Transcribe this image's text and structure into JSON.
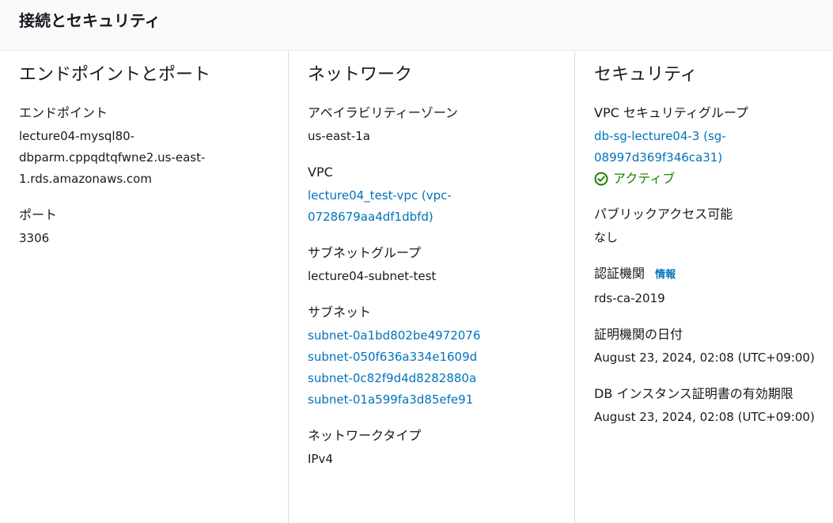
{
  "header": {
    "title": "接続とセキュリティ"
  },
  "endpoint_section": {
    "title": "エンドポイントとポート",
    "endpoint_label": "エンドポイント",
    "endpoint_line1": "lecture04-mysql80-",
    "endpoint_line2": "dbparm.cppqdtqfwne2.us-east-",
    "endpoint_line3": "1.rds.amazonaws.com",
    "port_label": "ポート",
    "port_value": "3306"
  },
  "network_section": {
    "title": "ネットワーク",
    "az_label": "アベイラビリティーゾーン",
    "az_value": "us-east-1a",
    "vpc_label": "VPC",
    "vpc_line1": "lecture04_test-vpc (vpc-",
    "vpc_line2": "0728679aa4df1dbfd)",
    "subnet_group_label": "サブネットグループ",
    "subnet_group_value": "lecture04-subnet-test",
    "subnets_label": "サブネット",
    "subnets": [
      "subnet-0a1bd802be4972076",
      "subnet-050f636a334e1609d",
      "subnet-0c82f9d4d8282880a",
      "subnet-01a599fa3d85efe91"
    ],
    "network_type_label": "ネットワークタイプ",
    "network_type_value": "IPv4"
  },
  "security_section": {
    "title": "セキュリティ",
    "sg_label": "VPC セキュリティグループ",
    "sg_line1": "db-sg-lecture04-3 (sg-",
    "sg_line2": "08997d369f346ca31)",
    "sg_status": "アクティブ",
    "status_color": "#1d8102",
    "public_label": "パブリックアクセス可能",
    "public_value": "なし",
    "ca_label": "認証機関",
    "ca_info": "情報",
    "ca_value": "rds-ca-2019",
    "ca_date_label": "証明機関の日付",
    "ca_date_value": "August 23, 2024, 02:08 (UTC+09:00)",
    "cert_expiry_label": "DB インスタンス証明書の有効期限",
    "cert_expiry_value": "August 23, 2024, 02:08 (UTC+09:00)"
  },
  "colors": {
    "link": "#0073bb",
    "text": "#16191f",
    "divider": "#d5dbdb"
  }
}
